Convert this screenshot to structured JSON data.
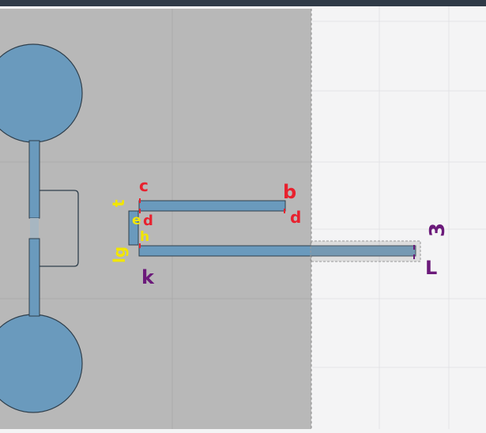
{
  "colors": {
    "background": "#f4f4f5",
    "topbar": "#2f3a47",
    "selection_fill": "#b8b8b8",
    "shape_fill": "#6a9abd",
    "shape_stroke": "#2f3f4c",
    "annotation_red": "#e8212e",
    "annotation_yellow": "#f2e600",
    "annotation_purple": "#6b1a7a"
  },
  "annotations": {
    "c": "c",
    "b": "b",
    "d_left": "d",
    "d_right": "d",
    "t": "t",
    "e": "e",
    "lg": "lg",
    "h": "h",
    "k": "k",
    "three": "3",
    "L": "L"
  }
}
